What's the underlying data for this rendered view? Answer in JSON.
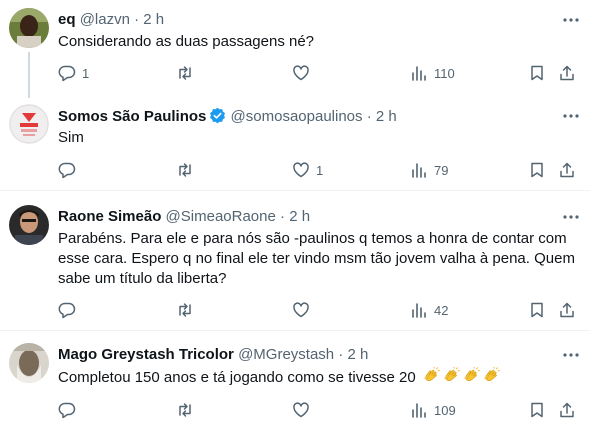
{
  "tweets": [
    {
      "name": "eq",
      "handle": "@lazvn",
      "time": "2 h",
      "text": "Considerando as duas passagens né?",
      "counts": {
        "replies": "1",
        "retweets": "",
        "likes": "",
        "views": "110"
      }
    },
    {
      "name": "Somos São Paulinos",
      "handle": "@somosaopaulinos",
      "time": "2 h",
      "text": "Sim",
      "counts": {
        "replies": "",
        "retweets": "",
        "likes": "1",
        "views": "79"
      }
    },
    {
      "name": "Raone Simeão",
      "handle": "@SimeaoRaone",
      "time": "2 h",
      "text": "Parabéns. Para ele e para nós são -paulinos q temos a honra de contar com esse cara. Espero q no final ele ter vindo msm tão jovem valha à pena. Quem sabe um título da liberta?",
      "counts": {
        "replies": "",
        "retweets": "",
        "likes": "",
        "views": "42"
      }
    },
    {
      "name": "Mago Greystash Tricolor",
      "handle": "@MGreystash",
      "time": "2 h",
      "text": "Completou 150 anos e tá jogando como se tivesse 20",
      "counts": {
        "replies": "",
        "retweets": "",
        "likes": "",
        "views": "109"
      }
    }
  ],
  "separator": "·",
  "clap_emoji_count": 4,
  "colors": {
    "text": "#0f1419",
    "muted": "#536471",
    "verified": "#1d9bf0",
    "divider": "#eff3f4"
  }
}
